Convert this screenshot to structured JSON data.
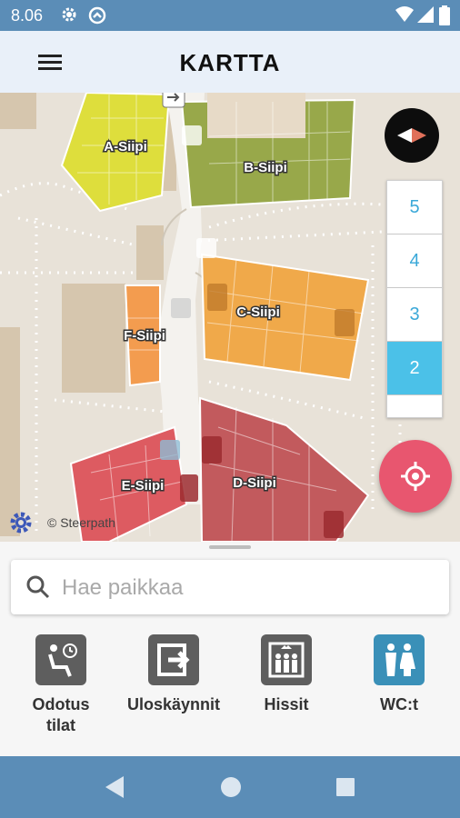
{
  "status_bar": {
    "time": "8.06",
    "icons": [
      "gear-icon",
      "sync-icon",
      "wifi-icon",
      "signal-icon",
      "battery-icon"
    ]
  },
  "app_bar": {
    "title": "KARTTA",
    "menu_icon": "hamburger-menu-icon"
  },
  "map": {
    "wings": [
      "A-Siipi",
      "B-Siipi",
      "C-Siipi",
      "D-Siipi",
      "E-Siipi",
      "F-Siipi"
    ],
    "wing_colors": {
      "A": "#dede3c",
      "B": "#98a84a",
      "C": "#f0a94a",
      "D": "#c25a5d",
      "E": "#dd5b61",
      "F": "#f39c4f"
    },
    "floors": [
      "5",
      "4",
      "3",
      "2"
    ],
    "active_floor": "2",
    "credit": "© Steerpath",
    "accent_color": "#4bc1e8",
    "locate_color": "#e8566f"
  },
  "search": {
    "placeholder": "Hae paikkaa",
    "value": ""
  },
  "categories": [
    {
      "label": "Odotus\ntilat",
      "icon": "waiting-room-icon"
    },
    {
      "label": "Uloskäynnit",
      "icon": "exit-icon"
    },
    {
      "label": "Hissit",
      "icon": "elevator-icon"
    },
    {
      "label": "WC:t",
      "icon": "restroom-icon"
    }
  ],
  "nav_bar": {
    "buttons": [
      "back-icon",
      "home-icon",
      "recents-icon"
    ]
  }
}
